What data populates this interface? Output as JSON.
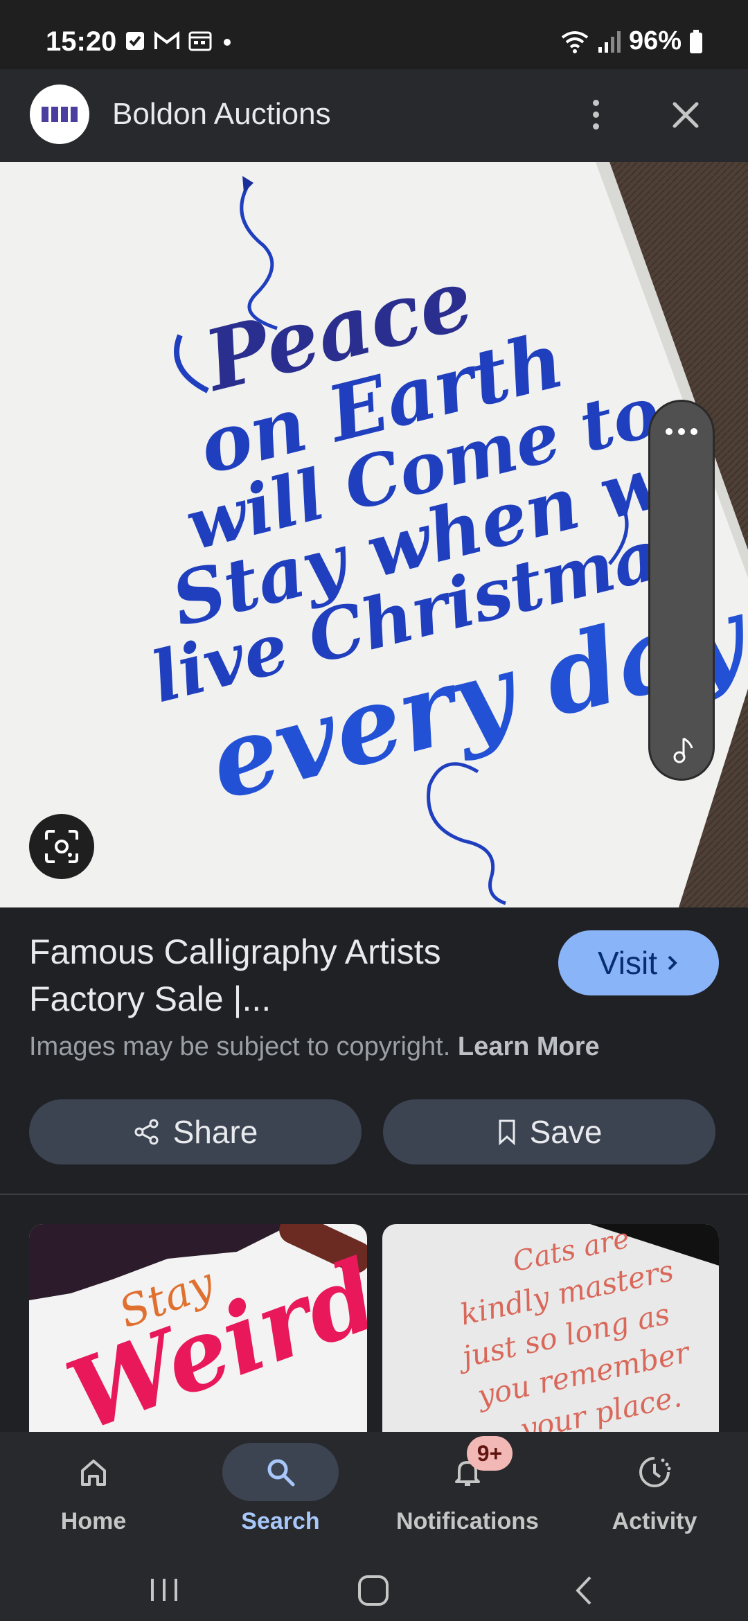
{
  "status_bar": {
    "time": "15:20",
    "battery": "96%",
    "icons": [
      "checkbox-icon",
      "gmail-icon",
      "calendar-icon",
      "dot-icon",
      "wifi-icon",
      "signal-icon",
      "battery-icon"
    ]
  },
  "header": {
    "title": "Boldon Auctions",
    "logo": "boldon-logo",
    "more_icon": "more-vert-icon",
    "close_icon": "close-icon"
  },
  "hero": {
    "calligraphy_lines": [
      "Peace",
      "on Earth",
      "will Come to",
      "Stay when we",
      "live Christmas",
      "every day"
    ],
    "lens_icon": "lens-icon",
    "side_panel": {
      "more_icon": "more-horiz-icon",
      "music_icon": "music-note-icon"
    }
  },
  "result": {
    "title_line1": "Famous Calligraphy Artists",
    "title_line2": "Factory Sale |...",
    "visit_label": "Visit",
    "copyright_text": "Images may be subject to copyright.",
    "learn_more": "Learn More",
    "share_label": "Share",
    "save_label": "Save"
  },
  "related": [
    {
      "words": [
        "Stay",
        "Weird"
      ]
    },
    {
      "words": [
        "Cats are",
        "kindly masters",
        "just so long as",
        "you remember",
        "your place."
      ]
    }
  ],
  "bottom_nav": {
    "items": [
      {
        "label": "Home",
        "icon": "home-icon",
        "active": false
      },
      {
        "label": "Search",
        "icon": "search-icon",
        "active": true
      },
      {
        "label": "Notifications",
        "icon": "bell-icon",
        "active": false
      },
      {
        "label": "Activity",
        "icon": "activity-icon",
        "active": false
      }
    ],
    "badge": "9+"
  },
  "colors": {
    "background": "#202124",
    "accent": "#8ab4f8",
    "button": "#3c4452",
    "ink": "#1f3fbf"
  }
}
